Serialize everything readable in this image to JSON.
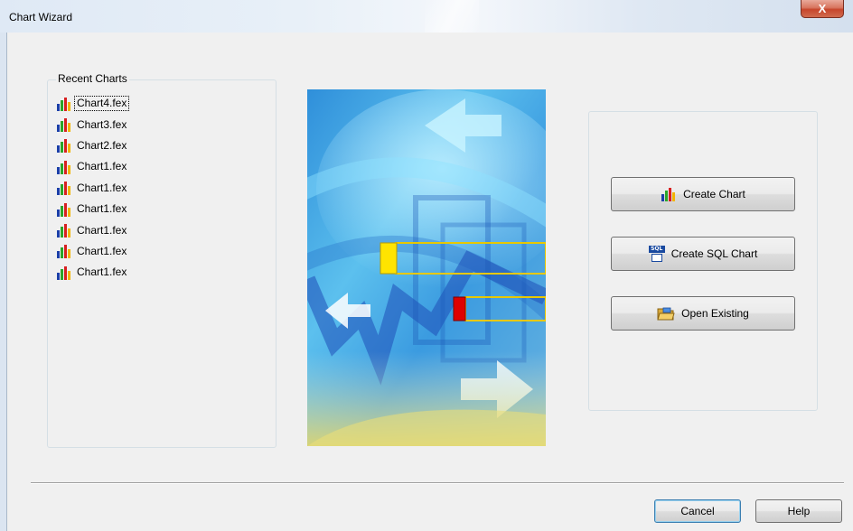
{
  "window": {
    "title": "Chart Wizard",
    "close_glyph": "X"
  },
  "recent": {
    "group_label": "Recent Charts",
    "items": [
      "Chart4.fex",
      "Chart3.fex",
      "Chart2.fex",
      "Chart1.fex",
      "Chart1.fex",
      "Chart1.fex",
      "Chart1.fex",
      "Chart1.fex",
      "Chart1.fex"
    ],
    "item_icon": "bar-chart-icon"
  },
  "actions": {
    "create_chart": "Create Chart",
    "create_sql_chart": "Create SQL Chart",
    "open_existing": "Open Existing",
    "sql_icon_text": "SQL"
  },
  "footer": {
    "cancel": "Cancel",
    "help": "Help"
  },
  "colors": {
    "accent": "#3c7fb1",
    "picture_blue": "#3fa9e6",
    "highlight_yellow": "#ffe400",
    "highlight_red": "#e00000"
  }
}
